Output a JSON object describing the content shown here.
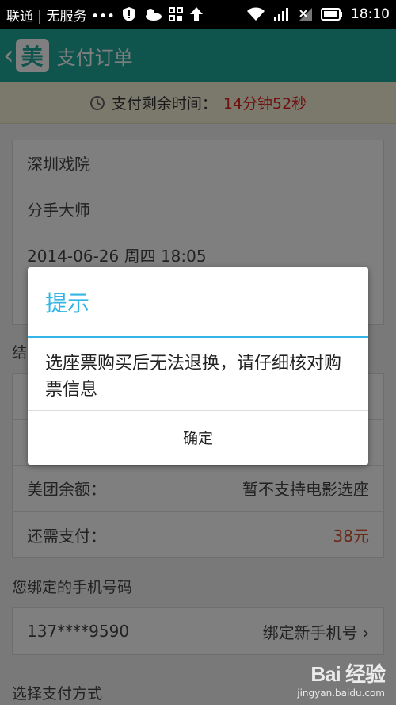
{
  "statusbar": {
    "carrier": "联通 | 无服务 •••",
    "time": "18:10"
  },
  "header": {
    "back_icon": "chevron-left-icon",
    "logo_text": "美",
    "title": "支付订单"
  },
  "timer": {
    "label": "支付剩余时间：",
    "value": "14分钟52秒"
  },
  "order": {
    "theater": "深圳戏院",
    "movie": "分手大师",
    "showtime": "2014-06-26 周四 18:05"
  },
  "settlement": {
    "section_label": "结",
    "balance_label": "美团余额：",
    "balance_value": "暂不支持电影选座",
    "due_label": "还需支付：",
    "due_value": "38元"
  },
  "phone": {
    "section_label": "您绑定的手机号码",
    "number": "137****9590",
    "bind_new": "绑定新手机号 ›"
  },
  "payment": {
    "section_label": "选择支付方式"
  },
  "dialog": {
    "title": "提示",
    "message": "选座票购买后无法退换，请仔细核对购票信息",
    "confirm": "确定"
  },
  "watermark": {
    "logo": "Bai 经验",
    "url": "jingyan.baidu.com"
  },
  "colors": {
    "header": "#1fa99b",
    "dialog_accent": "#33b5e5",
    "timer_value": "#e02020",
    "price": "#d9532c"
  }
}
